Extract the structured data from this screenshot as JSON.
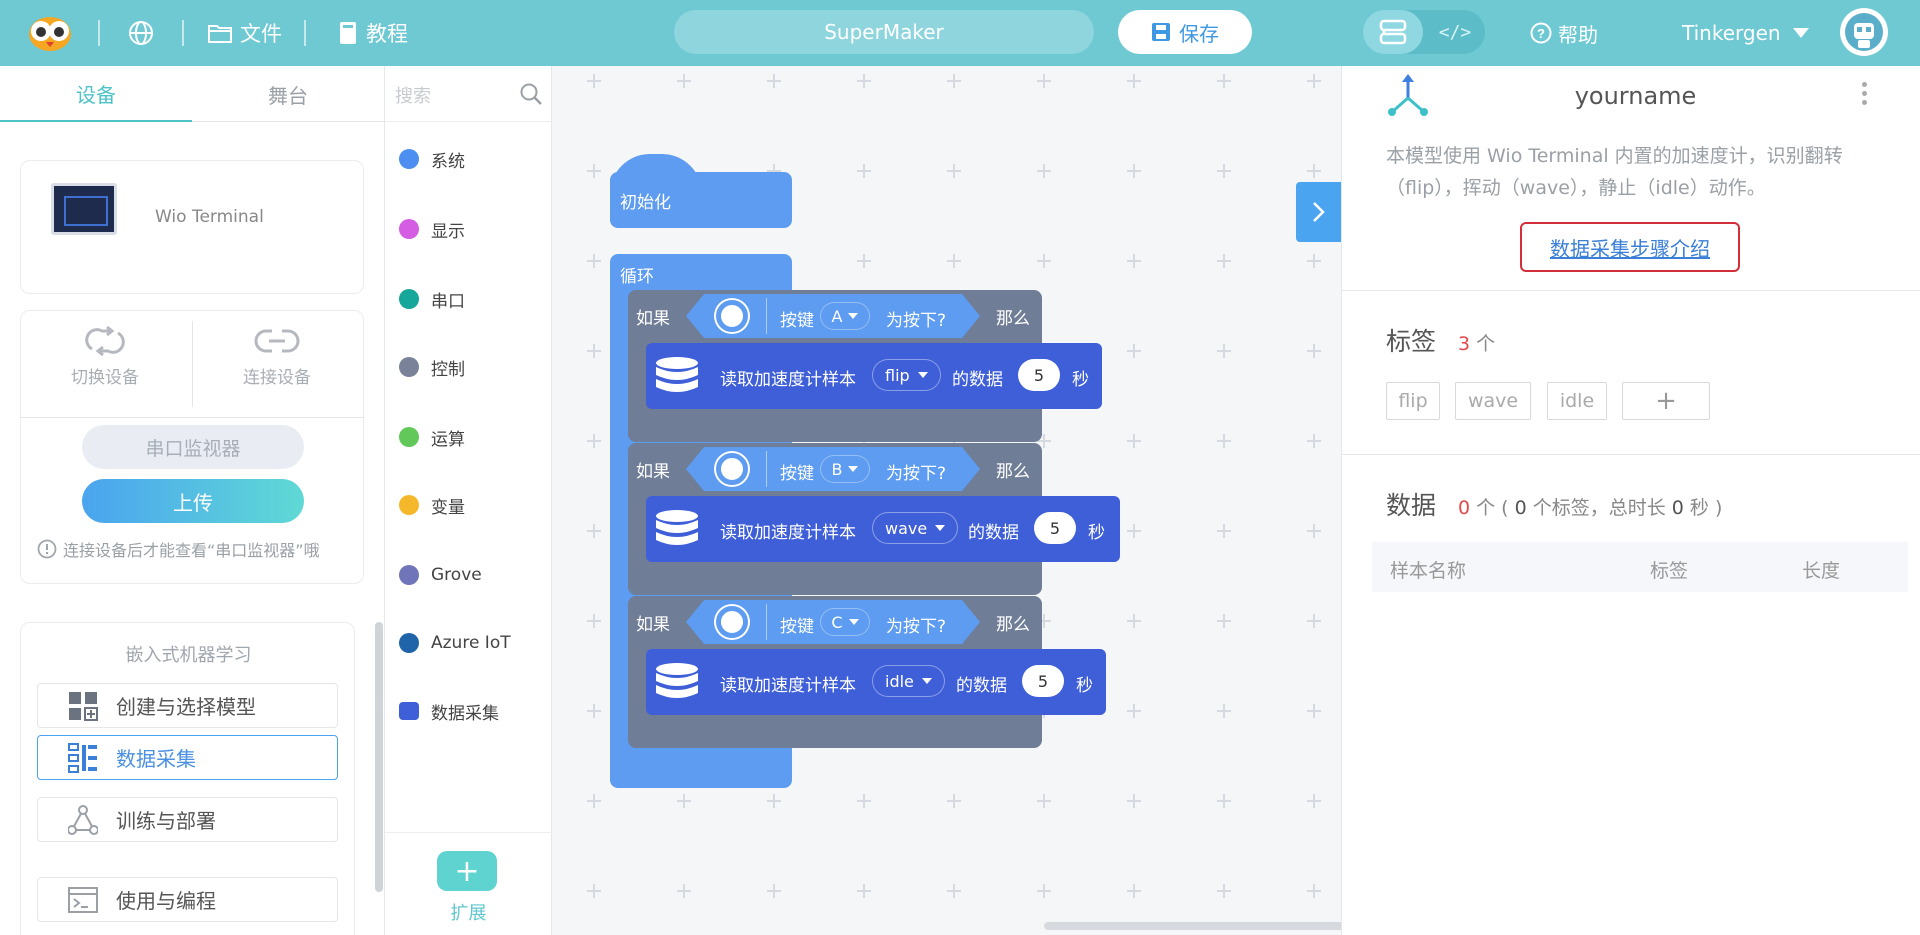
{
  "topbar": {
    "file_label": "文件",
    "tutorial_label": "教程",
    "project_name": "SuperMaker",
    "save_label": "保存",
    "code_icon_text": "</>",
    "help_label": "帮助",
    "username": "Tinkergen"
  },
  "left": {
    "tabs": [
      "设备",
      "舞台"
    ],
    "device_name": "Wio Terminal",
    "switch_label": "切换设备",
    "connect_label": "连接设备",
    "serial_label": "串口监视器",
    "upload_label": "上传",
    "hint": "连接设备后才能查看“串口监视器”哦",
    "ml_title": "嵌入式机器学习",
    "ml_items": [
      "创建与选择模型",
      "数据采集",
      "训练与部署",
      "使用与编程"
    ]
  },
  "categories": {
    "search_placeholder": "搜索",
    "items": [
      {
        "label": "系统",
        "color": "#4c8ff0"
      },
      {
        "label": "显示",
        "color": "#d45de3"
      },
      {
        "label": "串口",
        "color": "#17a69a"
      },
      {
        "label": "控制",
        "color": "#7a8299"
      },
      {
        "label": "运算",
        "color": "#62c85a"
      },
      {
        "label": "变量",
        "color": "#f5b82a"
      },
      {
        "label": "Grove",
        "color": "#6f75b8"
      },
      {
        "label": "Azure IoT",
        "color": "#1f64a8"
      },
      {
        "label": "数据采集",
        "color": "#3f5fd8"
      }
    ],
    "extension_label": "扩展"
  },
  "blocks": {
    "init_label": "初始化",
    "loop_label": "循环",
    "if_label": "如果",
    "then_label": "那么",
    "key_label": "按键",
    "pressed_label": "为按下?",
    "read_label": "读取加速度计样本",
    "of_label": "的数据",
    "sec_label": "秒",
    "rows": [
      {
        "key": "A",
        "sample": "flip",
        "seconds": "5"
      },
      {
        "key": "B",
        "sample": "wave",
        "seconds": "5"
      },
      {
        "key": "C",
        "sample": "idle",
        "seconds": "5"
      }
    ]
  },
  "right": {
    "model_name": "yourname",
    "description": "本模型使用 Wio Terminal 内置的加速度计，识别翻转（flip），挥动（wave），静止（idle）动作。",
    "intro_link": "数据采集步骤介绍",
    "tags_title": "标签",
    "tags_count": "3",
    "count_unit": "个",
    "tags": [
      "flip",
      "wave",
      "idle"
    ],
    "add_tag": "+",
    "data_title": "数据",
    "data_count": "0",
    "data_detail_prefix": "个 (",
    "data_tag_count": "0",
    "data_detail_mid": " 个标签，总时长",
    "data_duration": "0",
    "data_detail_suffix": " 秒 )",
    "columns": [
      "样本名称",
      "标签",
      "长度"
    ]
  },
  "colors": {
    "topbar": "#6fc9d3",
    "accent": "#4ec3c8",
    "block_blue": "#5d9cf0",
    "block_grey": "#6f7d96",
    "data_block": "#3f5fd8",
    "highlight_border": "#d32f3a"
  }
}
